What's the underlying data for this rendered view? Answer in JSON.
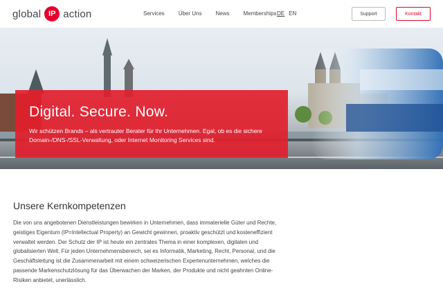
{
  "header": {
    "logo": {
      "left": "global",
      "badge": "IP",
      "right": "action"
    },
    "nav": [
      "Services",
      "Über Uns",
      "News",
      "Memberships"
    ],
    "languages": [
      {
        "code": "DE",
        "active": true
      },
      {
        "code": "EN",
        "active": false
      }
    ],
    "support_label": "Support",
    "contact_label": "Kontakt"
  },
  "hero": {
    "title": "Digital. Secure. Now.",
    "text": "Wir schützen Brands – als vertrauter Berater für Ihr Unternehmen. Egal, ob es die sichere Domain-/DNS-/SSL-Verwaltung, oder Internet Monitoring Services sind."
  },
  "section": {
    "title": "Unsere Kernkompetenzen",
    "text": "Die von uns angebotenen Dienstleistungen bewirken in Unternehmen, dass immaterielle Güter und Rechte, geistiges Eigentum (IP=Intellectual Property) an Gewicht gewinnen, proaktiv geschützt und kosteneffizient verwaltet werden. Der Schutz der IP ist heute ein zentrales Thema in einer komplexen, digitalen und globalisierten Welt. Für jeden Unternehmensbereich, sei es Informatik, Marketing, Recht, Personal, und die Geschäftsleitung ist die Zusammenarbeit mit einem schweizerischen Expertenunternehmen, welches die passende Markenschutzlösung für das Überwachen der Marken, der Produkte und nicht geahnten Online-Risiken anbietet, unerlässlich."
  },
  "colors": {
    "brand_red": "#e4002b",
    "hero_box": "#e21e2d"
  }
}
